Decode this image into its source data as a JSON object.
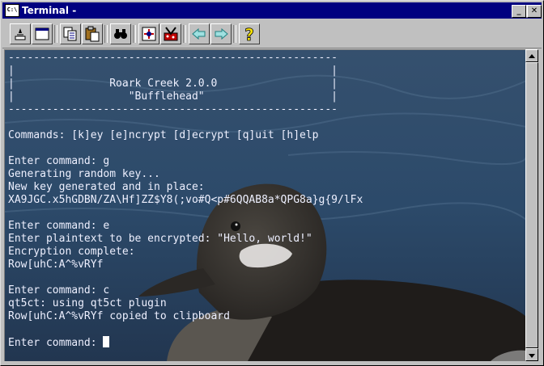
{
  "window": {
    "title": "Terminal -",
    "app_icon_label": "C:\\",
    "controls": {
      "minimize": "_",
      "maximize": "□",
      "close": "✕"
    }
  },
  "toolbar": {
    "buttons": [
      {
        "icon": "new-terminal-icon"
      },
      {
        "icon": "window-icon"
      },
      {
        "icon": "copy-icon"
      },
      {
        "icon": "paste-icon"
      },
      {
        "icon": "binoculars-icon"
      },
      {
        "icon": "settings-icon"
      },
      {
        "icon": "tools-icon"
      },
      {
        "icon": "back-arrow-icon"
      },
      {
        "icon": "forward-arrow-icon"
      },
      {
        "icon": "help-icon"
      }
    ],
    "help_glyph": "?"
  },
  "terminal": {
    "banner_border": "----------------------------------------------------",
    "banner_blank": "|                                                  |",
    "banner_line1": "|               Roark Creek 2.0.0                  |",
    "banner_line2": "|                  \"Bufflehead\"                    |",
    "commands": "Commands: [k]ey [e]ncrypt [d]ecrypt [q]uit [h]elp",
    "prompt1": "Enter command: g",
    "out1a": "Generating random key...",
    "out1b": "New key generated and in place:",
    "out1c": "XA9JGC.x5hGDBN/ZA\\Hf]ZZ$Y8(;vo#Q<p#6QQAB8a*QPG8a}g{9/lFx",
    "prompt2": "Enter command: e",
    "out2a": "Enter plaintext to be encrypted: \"Hello, world!\"",
    "out2b": "Encryption complete:",
    "out2c": "Row[uhC:A^%vRYf",
    "prompt3": "Enter command: c",
    "out3a": "qt5ct: using qt5ct plugin",
    "out3b": "Row[uhC:A^%vRYf copied to clipboard",
    "prompt4": "Enter command: "
  },
  "colors": {
    "titlebar": "#000080",
    "text": "#eef0ff",
    "chrome": "#c0c0c0"
  }
}
